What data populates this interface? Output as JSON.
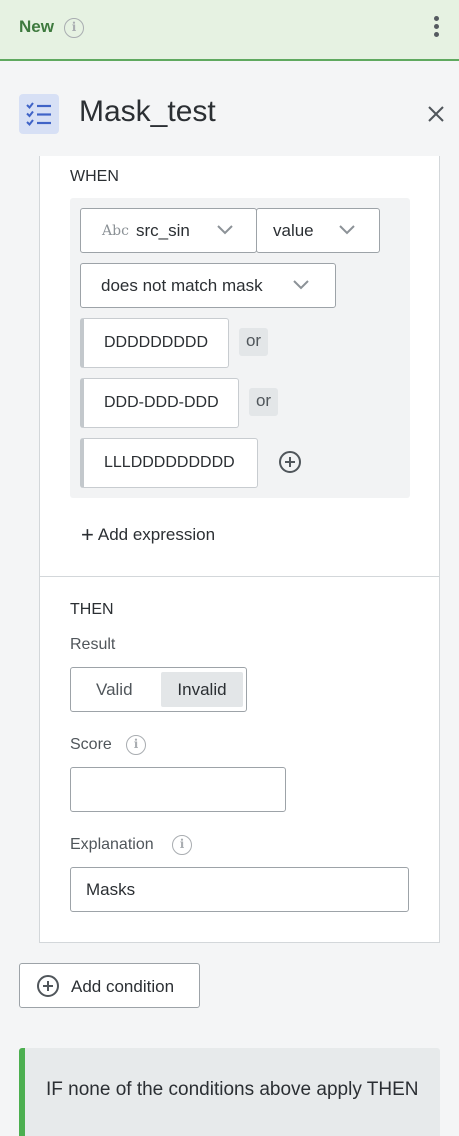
{
  "header": {
    "status": "New",
    "status_info_icon": "info-icon",
    "menu_icon": "kebab-menu-icon"
  },
  "rule": {
    "title": "Mask_test",
    "icon": "checklist-icon",
    "close_icon": "close-icon"
  },
  "when": {
    "label": "WHEN",
    "field": {
      "type_badge": "Abc",
      "name": "src_sin"
    },
    "attribute": "value",
    "operator": "does not match mask",
    "masks": [
      "DDDDDDDDD",
      "DDD-DDD-DDD",
      "LLLDDDDDDDDD"
    ],
    "or_label": "or",
    "add_expression": "Add expression"
  },
  "then": {
    "label": "THEN",
    "result_label": "Result",
    "result_options": [
      "Valid",
      "Invalid"
    ],
    "result_selected": "Invalid",
    "score_label": "Score",
    "score_value": "",
    "explanation_label": "Explanation",
    "explanation_value": "Masks"
  },
  "add_condition": "Add condition",
  "else_block": {
    "text": "IF none of the conditions above apply THEN"
  },
  "colors": {
    "status_green": "#3e7a3e",
    "header_bg": "#e6f2e2",
    "accent_blue": "#3f63c7",
    "else_bar": "#4caf50"
  }
}
